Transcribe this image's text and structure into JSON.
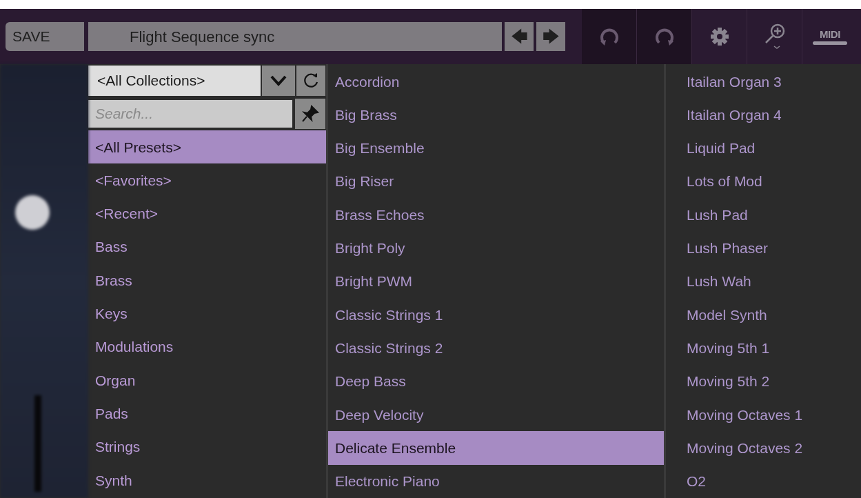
{
  "toolbar": {
    "save": "SAVE",
    "preset_name": "Flight Sequence sync",
    "prev": "🡄",
    "next": "🡆",
    "midi": "MIDI"
  },
  "browser": {
    "collection": "<All Collections>",
    "search": {
      "placeholder": "Search..."
    },
    "categories": [
      {
        "label": "<All Presets>",
        "selected": true
      },
      {
        "label": "<Favorites>",
        "selected": false
      },
      {
        "label": "<Recent>",
        "selected": false
      },
      {
        "label": "Bass",
        "selected": false
      },
      {
        "label": "Brass",
        "selected": false
      },
      {
        "label": "Keys",
        "selected": false
      },
      {
        "label": "Modulations",
        "selected": false
      },
      {
        "label": "Organ",
        "selected": false
      },
      {
        "label": "Pads",
        "selected": false
      },
      {
        "label": "Strings",
        "selected": false
      },
      {
        "label": "Synth",
        "selected": false
      }
    ],
    "presets": [
      {
        "label": "Accordion",
        "selected": false
      },
      {
        "label": "Big Brass",
        "selected": false
      },
      {
        "label": "Big Ensemble",
        "selected": false
      },
      {
        "label": "Big Riser",
        "selected": false
      },
      {
        "label": "Brass Echoes",
        "selected": false
      },
      {
        "label": "Bright Poly",
        "selected": false
      },
      {
        "label": "Bright PWM",
        "selected": false
      },
      {
        "label": "Classic Strings 1",
        "selected": false
      },
      {
        "label": "Classic Strings 2",
        "selected": false
      },
      {
        "label": "Deep Bass",
        "selected": false
      },
      {
        "label": "Deep Velocity",
        "selected": false
      },
      {
        "label": "Delicate Ensemble",
        "selected": true
      },
      {
        "label": "Electronic Piano",
        "selected": false
      },
      {
        "label": "Itailan Organ 3",
        "selected": false
      },
      {
        "label": "Itailan Organ 4",
        "selected": false
      },
      {
        "label": "Liquid Pad",
        "selected": false
      },
      {
        "label": "Lots of Mod",
        "selected": false
      },
      {
        "label": "Lush Pad",
        "selected": false
      },
      {
        "label": "Lush Phaser",
        "selected": false
      },
      {
        "label": "Lush Wah",
        "selected": false
      },
      {
        "label": "Model Synth",
        "selected": false
      },
      {
        "label": "Moving 5th 1",
        "selected": false
      },
      {
        "label": "Moving 5th 2",
        "selected": false
      },
      {
        "label": "Moving Octaves 1",
        "selected": false
      },
      {
        "label": "Moving Octaves 2",
        "selected": false
      },
      {
        "label": "O2",
        "selected": false
      }
    ]
  }
}
